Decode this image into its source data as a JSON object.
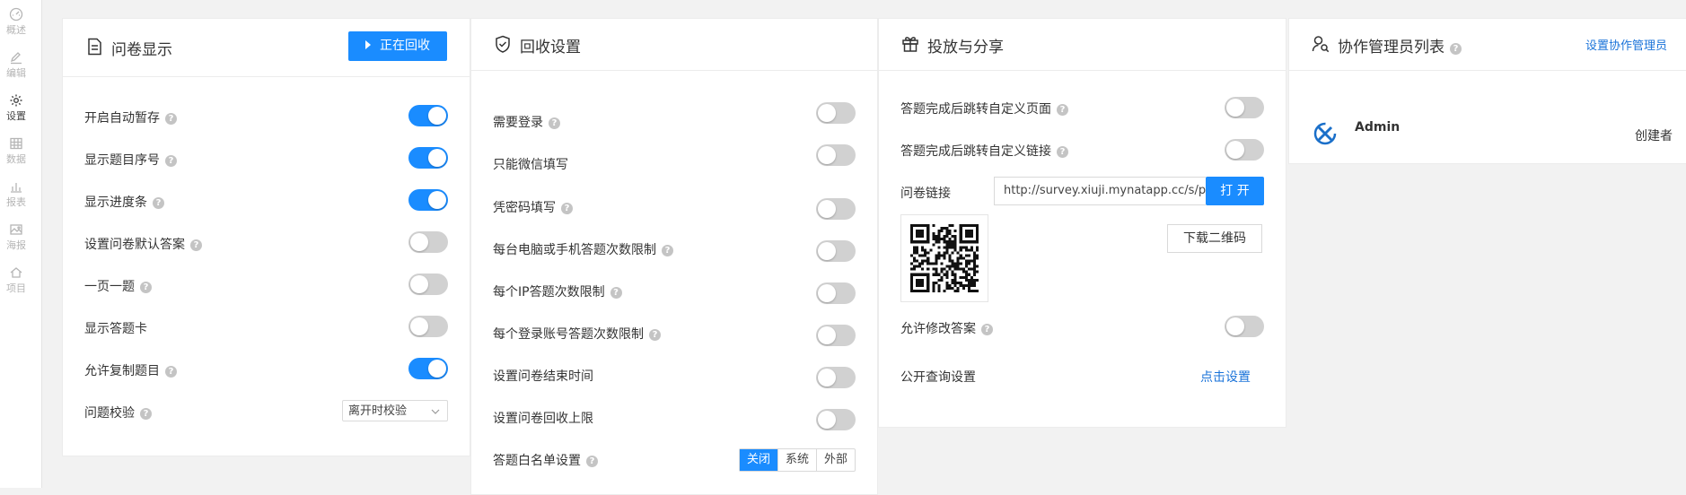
{
  "sidebar": {
    "items": [
      {
        "label": "概述",
        "icon": "dashboard-icon",
        "active": false
      },
      {
        "label": "编辑",
        "icon": "edit-icon",
        "active": false
      },
      {
        "label": "设置",
        "icon": "gear-icon",
        "active": true
      },
      {
        "label": "数据",
        "icon": "table-icon",
        "active": false
      },
      {
        "label": "报表",
        "icon": "bar-chart-icon",
        "active": false
      },
      {
        "label": "海报",
        "icon": "image-icon",
        "active": false
      },
      {
        "label": "项目",
        "icon": "home-icon",
        "active": false
      }
    ]
  },
  "display_panel": {
    "title": "问卷显示",
    "recycle_button": "正在回收",
    "rows": [
      {
        "label": "开启自动暂存",
        "on": true
      },
      {
        "label": "显示题目序号",
        "on": true
      },
      {
        "label": "显示进度条",
        "on": true
      },
      {
        "label": "设置问卷默认答案",
        "on": false
      },
      {
        "label": "一页一题",
        "on": false
      },
      {
        "label": "显示答题卡",
        "on": false
      },
      {
        "label": "允许复制题目",
        "on": true
      }
    ],
    "validation_label": "问题校验",
    "validation_value": "离开时校验"
  },
  "recycle_panel": {
    "title": "回收设置",
    "rows": [
      {
        "label": "需要登录",
        "on": false
      },
      {
        "label": "只能微信填写",
        "on": false
      },
      {
        "label": "凭密码填写",
        "on": false
      },
      {
        "label": "每台电脑或手机答题次数限制",
        "on": false
      },
      {
        "label": "每个IP答题次数限制",
        "on": false
      },
      {
        "label": "每个登录账号答题次数限制",
        "on": false
      },
      {
        "label": "设置问卷结束时间",
        "on": false
      },
      {
        "label": "设置问卷回收上限",
        "on": false
      }
    ],
    "whitelist_label": "答题白名单设置",
    "whitelist_options": [
      "关闭",
      "系统",
      "外部"
    ],
    "whitelist_selected": "关闭"
  },
  "share_panel": {
    "title": "投放与分享",
    "redirect_page_label": "答题完成后跳转自定义页面",
    "redirect_link_label": "答题完成后跳转自定义链接",
    "link_label": "问卷链接",
    "link_value": "http://survey.xiuji.mynatapp.cc/s/p",
    "open_button": "打 开",
    "download_qr_button": "下载二维码",
    "allow_modify_label": "允许修改答案",
    "public_query_label": "公开查询设置",
    "public_query_link": "点击设置"
  },
  "collab_panel": {
    "title": "协作管理员列表",
    "set_link": "设置协作管理员",
    "user_name": "Admin",
    "user_role": "创建者"
  },
  "colors": {
    "accent": "#1a8cff",
    "toggle_off": "#d1d1d1",
    "background": "#f2f2f2"
  }
}
